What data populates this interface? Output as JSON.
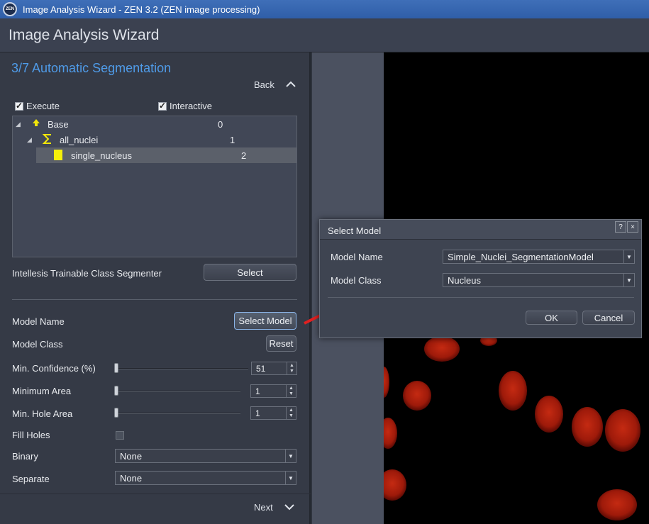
{
  "window": {
    "title": "Image Analysis Wizard - ZEN 3.2 (ZEN image processing)",
    "app_icon_text": "ZEN"
  },
  "header": {
    "title": "Image Analysis Wizard"
  },
  "wizard": {
    "step_title": "3/7 Automatic Segmentation",
    "back_label": "Back",
    "next_label": "Next",
    "execute_label": "Execute",
    "execute_checked": true,
    "interactive_label": "Interactive",
    "interactive_checked": true
  },
  "tree": {
    "rows": [
      {
        "label": "Base",
        "value": "0",
        "icon": "arrow-up-icon"
      },
      {
        "label": "all_nuclei",
        "value": "1",
        "icon": "sigma-icon"
      },
      {
        "label": "single_nucleus",
        "value": "2",
        "icon": "yellow-square-icon",
        "selected": true
      }
    ]
  },
  "segmenter": {
    "label": "Intellesis Trainable Class Segmenter",
    "select_button": "Select"
  },
  "params": {
    "model_name_label": "Model Name",
    "select_model_button": "Select Model",
    "model_class_label": "Model Class",
    "reset_button": "Reset",
    "min_confidence_label": "Min. Confidence (%)",
    "min_confidence_value": "51",
    "minimum_area_label": "Minimum Area",
    "minimum_area_value": "1",
    "min_hole_area_label": "Min. Hole Area",
    "min_hole_area_value": "1",
    "fill_holes_label": "Fill Holes",
    "fill_holes_checked": false,
    "binary_label": "Binary",
    "binary_value": "None",
    "separate_label": "Separate",
    "separate_value": "None"
  },
  "dialog": {
    "title": "Select Model",
    "help_button": "?",
    "close_button": "×",
    "model_name_label": "Model Name",
    "model_name_value": "Simple_Nuclei_SegmentationModel",
    "model_class_label": "Model Class",
    "model_class_value": "Nucleus",
    "ok_button": "OK",
    "cancel_button": "Cancel"
  },
  "colors": {
    "accent": "#4f9be8",
    "arrow": "#e02020",
    "nuclei": "#c0200f"
  }
}
